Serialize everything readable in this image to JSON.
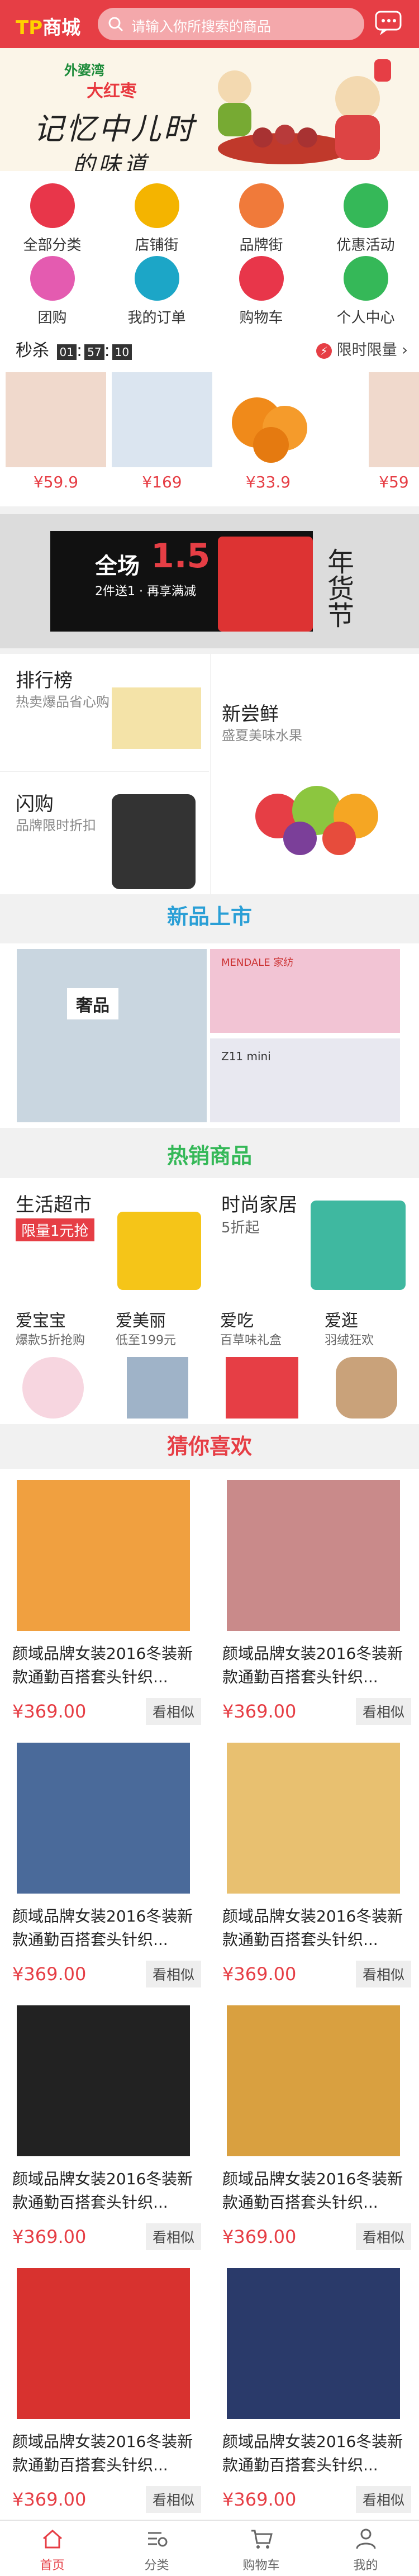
{
  "header": {
    "logo_tp": "TP",
    "logo_text": "商城",
    "search_placeholder": "请输入你所搜索的商品",
    "msg_label": "消息"
  },
  "hero": {
    "line1": "外婆湾",
    "line2": "大红枣",
    "line3": "记忆中儿时",
    "line4": "的味道"
  },
  "icon_grid": [
    {
      "label": "全部分类",
      "color": "#e8364a",
      "icon": "grid-icon"
    },
    {
      "label": "店铺街",
      "color": "#f4b400",
      "icon": "store-icon"
    },
    {
      "label": "品牌街",
      "color": "#f07a3a",
      "icon": "tag-icon"
    },
    {
      "label": "优惠活动",
      "color": "#35b858",
      "icon": "gift-icon"
    },
    {
      "label": "团购",
      "color": "#e45bb0",
      "icon": "sale-icon"
    },
    {
      "label": "我的订单",
      "color": "#1ca6c7",
      "icon": "order-icon"
    },
    {
      "label": "购物车",
      "color": "#e8364a",
      "icon": "cart-icon"
    },
    {
      "label": "个人中心",
      "color": "#35b858",
      "icon": "user-icon"
    }
  ],
  "flash_sale": {
    "title": "秒杀",
    "timer": [
      "01",
      "57",
      "10"
    ],
    "more": "限时限量",
    "items": [
      {
        "price": "¥59.9",
        "color": "#e8c8b8"
      },
      {
        "price": "¥169",
        "color": "#c7d6e8"
      },
      {
        "price": "¥33.9",
        "color": "#f08a1a"
      },
      {
        "price": "¥59",
        "color": "#e8c8b8"
      }
    ]
  },
  "banner": {
    "big": "全场",
    "num": "1.5",
    "sub": "2件送1 · 再享满减",
    "deco": "年货节",
    "brand_color": "#e63e45"
  },
  "promos": [
    {
      "title": "排行榜",
      "sub": "热卖爆品省心购"
    },
    {
      "title": "新尝鲜",
      "sub": "盛夏美味水果"
    },
    {
      "title": "闪购",
      "sub": "品牌限时折扣"
    }
  ],
  "sections": {
    "new": "新品上市",
    "hot": "热销商品",
    "guess": "猜你喜欢"
  },
  "new_products": {
    "tile1_label": "奢品",
    "tile2_label": "MENDALE 家纺",
    "tile3_label": "Z11 mini"
  },
  "hot_products": [
    {
      "name": "生活超市",
      "sub": "",
      "tag": "限量1元抢"
    },
    {
      "name": "时尚家居",
      "sub": "5折起",
      "tag": ""
    },
    {
      "name": "爱宝宝",
      "sub": "爆款5折抢购",
      "tag": ""
    },
    {
      "name": "爱美丽",
      "sub": "低至199元",
      "tag": ""
    },
    {
      "name": "爱吃",
      "sub": "百草味礼盒",
      "tag": ""
    },
    {
      "name": "爱逛",
      "sub": "羽绒狂欢",
      "tag": ""
    }
  ],
  "guess_items": [
    {
      "title": "颜域品牌女装2016冬装新款通勤百搭套头针织...",
      "price": "¥369.00",
      "btn": "看相似",
      "color": "#f0a040"
    },
    {
      "title": "颜域品牌女装2016冬装新款通勤百搭套头针织...",
      "price": "¥369.00",
      "btn": "看相似",
      "color": "#c98a8a"
    },
    {
      "title": "颜域品牌女装2016冬装新款通勤百搭套头针织...",
      "price": "¥369.00",
      "btn": "看相似",
      "color": "#4a6a9a"
    },
    {
      "title": "颜域品牌女装2016冬装新款通勤百搭套头针织...",
      "price": "¥369.00",
      "btn": "看相似",
      "color": "#e8c070"
    },
    {
      "title": "颜域品牌女装2016冬装新款通勤百搭套头针织...",
      "price": "¥369.00",
      "btn": "看相似",
      "color": "#222222"
    },
    {
      "title": "颜域品牌女装2016冬装新款通勤百搭套头针织...",
      "price": "¥369.00",
      "btn": "看相似",
      "color": "#d9a040"
    },
    {
      "title": "颜域品牌女装2016冬装新款通勤百搭套头针织...",
      "price": "¥369.00",
      "btn": "看相似",
      "color": "#d8322f"
    },
    {
      "title": "颜域品牌女装2016冬装新款通勤百搭套头针织...",
      "price": "¥369.00",
      "btn": "看相似",
      "color": "#2a3a6a"
    }
  ],
  "tabbar": [
    {
      "label": "首页",
      "icon": "home-icon",
      "active": true
    },
    {
      "label": "分类",
      "icon": "search-list-icon",
      "active": false
    },
    {
      "label": "购物车",
      "icon": "cart-icon",
      "active": false
    },
    {
      "label": "我的",
      "icon": "user-icon",
      "active": false
    }
  ]
}
